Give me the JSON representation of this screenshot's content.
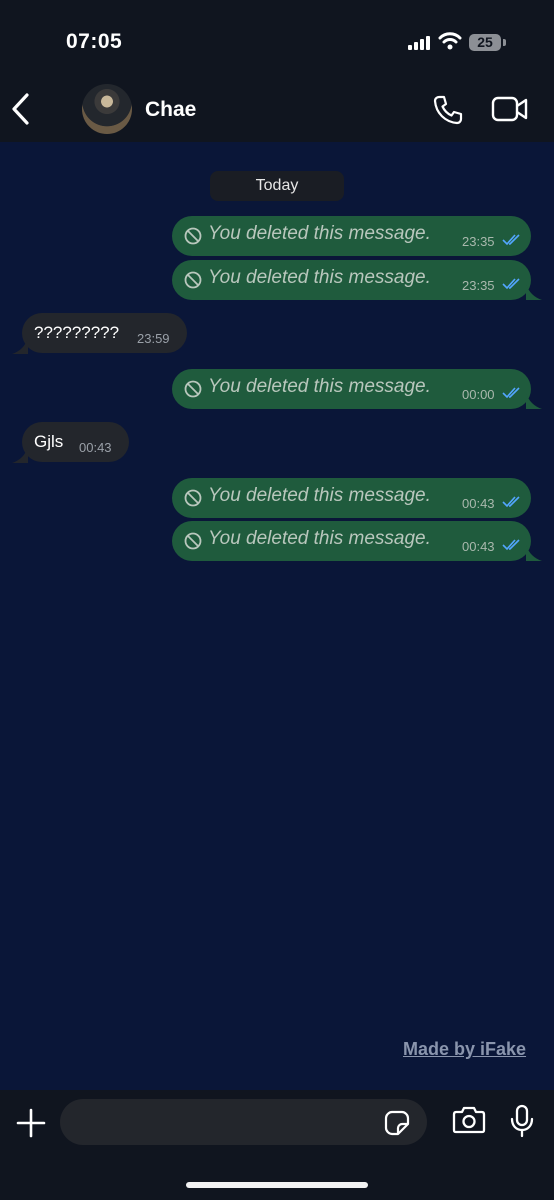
{
  "status_bar": {
    "time": "07:05",
    "battery": "25"
  },
  "header": {
    "contact_name": "Chae"
  },
  "chat": {
    "date_label": "Today",
    "deleted_text": "You deleted this message.",
    "messages": [
      {
        "direction": "out",
        "text": "You deleted this message.",
        "time": "23:35"
      },
      {
        "direction": "out",
        "text": "You deleted this message.",
        "time": "23:35"
      },
      {
        "direction": "in",
        "text": "?????????",
        "time": "23:59"
      },
      {
        "direction": "out",
        "text": "You deleted this message.",
        "time": "00:00"
      },
      {
        "direction": "in",
        "text": "Gjls",
        "time": "00:43"
      },
      {
        "direction": "out",
        "text": "You deleted this message.",
        "time": "00:43"
      },
      {
        "direction": "out",
        "text": "You deleted this message.",
        "time": "00:43"
      }
    ]
  },
  "watermark": "Made by iFake",
  "colors": {
    "background": "#0a1638",
    "outgoing": "#1f5b3d",
    "incoming": "#23262c",
    "tick": "#53a6ff"
  },
  "icons": [
    "back-icon",
    "phone-icon",
    "video-call-icon",
    "ban-icon",
    "read-ticks-icon",
    "plus-icon",
    "sticker-icon",
    "camera-icon",
    "microphone-icon"
  ]
}
